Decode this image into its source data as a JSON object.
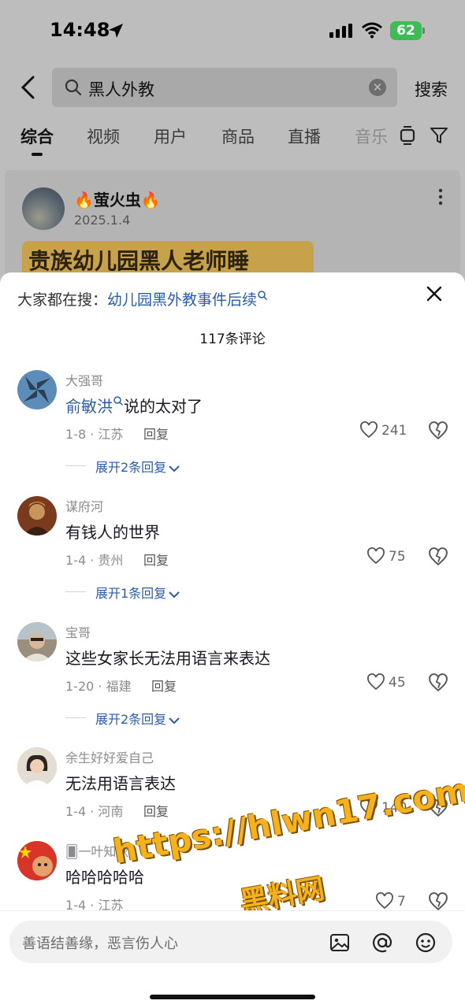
{
  "status_bar": {
    "time": "14:48",
    "battery": "62"
  },
  "search": {
    "query": "黑人外教",
    "submit_label": "搜索"
  },
  "tabs": [
    {
      "label": "综合",
      "active": true
    },
    {
      "label": "视频"
    },
    {
      "label": "用户"
    },
    {
      "label": "商品"
    },
    {
      "label": "直播"
    },
    {
      "label": "音乐"
    }
  ],
  "post": {
    "author": "🔥萤火虫🔥",
    "date": "2025.1.4",
    "banner_text": "贵族幼儿园黑人老师睡"
  },
  "sheet": {
    "suggest_prefix": "大家都在搜：",
    "suggest_link": "幼儿园黑外教事件后续",
    "comment_count": "117条评论",
    "reply_label": "回复"
  },
  "comments": [
    {
      "user": "大强哥",
      "mention": "俞敏洪",
      "text": "说的太对了",
      "meta": "1-8 · 江苏",
      "likes": "241",
      "expand": "展开2条回复",
      "avatar_color": "#5b8db8"
    },
    {
      "user": "谋府河",
      "mention": "",
      "text": "有钱人的世界",
      "meta": "1-4 · 贵州",
      "likes": "75",
      "expand": "展开1条回复",
      "avatar_color": "#7a3a1e"
    },
    {
      "user": "宝哥",
      "mention": "",
      "text": "这些女家长无法用语言来表达",
      "meta": "1-20 · 福建",
      "likes": "45",
      "expand": "展开2条回复",
      "avatar_color": "#9a8f7f"
    },
    {
      "user": "余生好好爱自己",
      "mention": "",
      "text": "无法用语言表达",
      "meta": "1-4 · 河南",
      "likes": "140",
      "expand": "",
      "avatar_color": "#c8b9a8"
    },
    {
      "user": "🂠一叶知秋",
      "mention": "",
      "text": "哈哈哈哈哈",
      "meta": "1-4 · 江苏",
      "likes": "7",
      "expand": "",
      "avatar_color": "#d8342a"
    }
  ],
  "input": {
    "placeholder": "善语结善缘，恶言伤人心"
  },
  "watermark": {
    "line1": "https://hlwn17.com",
    "line2": "黑料网"
  },
  "colors": {
    "link": "#2a5caa",
    "battery": "#3bbd54",
    "watermark": "#f6b21b"
  },
  "icons": [
    "location-arrow-icon",
    "signal-icon",
    "wifi-icon",
    "back-chevron-icon",
    "search-icon",
    "clear-icon",
    "layout-icon",
    "filter-icon",
    "more-icon",
    "close-icon",
    "heart-icon",
    "broken-heart-icon",
    "chevron-down-icon",
    "image-icon",
    "at-icon",
    "emoji-icon"
  ]
}
